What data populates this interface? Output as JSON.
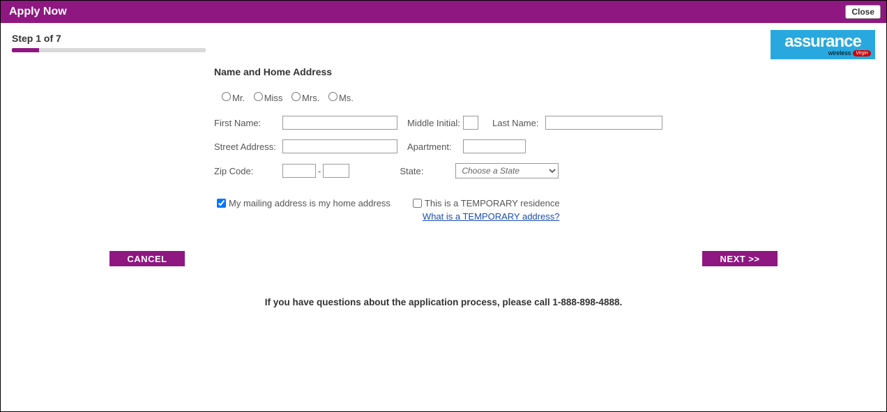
{
  "header": {
    "title": "Apply Now",
    "close_label": "Close"
  },
  "progress": {
    "step_label": "Step 1 of 7",
    "percent": 14
  },
  "logo": {
    "main": "assurance",
    "sub": "wireless",
    "tag": "Virgin"
  },
  "form": {
    "section_title": "Name and Home Address",
    "titles": {
      "mr": "Mr.",
      "miss": "Miss",
      "mrs": "Mrs.",
      "ms": "Ms."
    },
    "labels": {
      "first_name": "First Name:",
      "middle_initial": "Middle Initial:",
      "last_name": "Last Name:",
      "street_address": "Street Address:",
      "apartment": "Apartment:",
      "zip_code": "Zip Code:",
      "state": "State:"
    },
    "values": {
      "first_name": "",
      "middle_initial": "",
      "last_name": "",
      "street_address": "",
      "apartment": "",
      "zip1": "",
      "zip2": "",
      "state_placeholder": "Choose a State"
    },
    "checkboxes": {
      "mailing_home": {
        "label": "My mailing address is my home address",
        "checked": true
      },
      "temporary": {
        "label": "This is a TEMPORARY residence",
        "checked": false
      }
    },
    "temporary_link": "What is a TEMPORARY address?"
  },
  "buttons": {
    "cancel": "CANCEL",
    "next": "NEXT >>"
  },
  "help_text": "If you have questions about the application process, please call 1-888-898-4888."
}
